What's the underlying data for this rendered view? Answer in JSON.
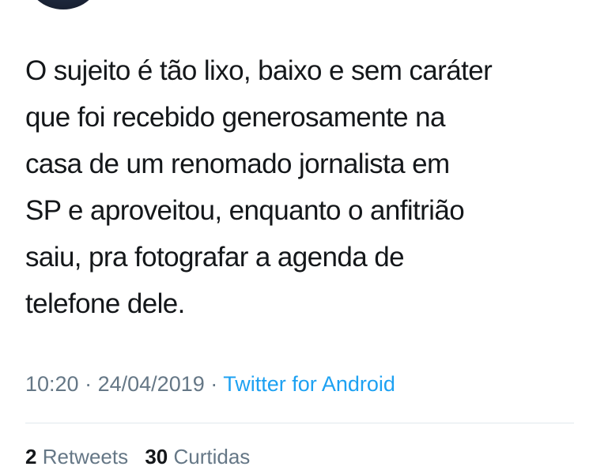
{
  "tweet": {
    "lines": [
      "O sujeito é tão lixo, baixo e sem caráter",
      "que foi recebido generosamente na",
      "casa de um renomado jornalista em",
      "SP e aproveitou, enquanto o anfitrião",
      "saiu, pra fotografar a agenda de",
      "telefone dele."
    ],
    "time": "10:20",
    "date": "24/04/2019",
    "separator": "·",
    "source": "Twitter for Android"
  },
  "stats": {
    "retweets_count": "2",
    "retweets_label": "Retweets",
    "likes_count": "30",
    "likes_label": "Curtidas"
  },
  "colors": {
    "text": "#14171a",
    "muted": "#657786",
    "link": "#1da1f2",
    "divider": "#e1e8ed"
  }
}
